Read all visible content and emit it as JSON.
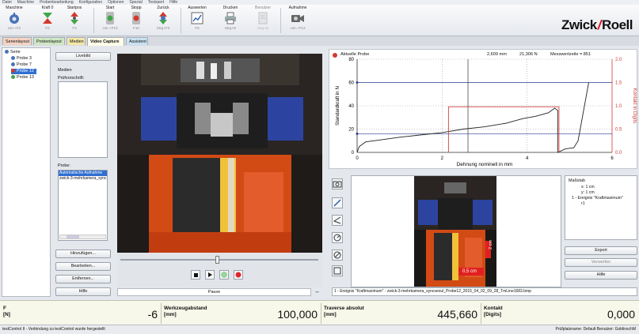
{
  "menu": [
    "Datei",
    "Maschine",
    "Probenbearbeitung",
    "Konfiguration",
    "Optionen",
    "Spezial",
    "Testxpert",
    "Hilfe"
  ],
  "toolbar": {
    "maschine": {
      "label": "Maschine",
      "shortcut": "Um.+F2"
    },
    "kraft0": {
      "label": "Kraft 0",
      "shortcut": "F2"
    },
    "startpos": {
      "label": "Startpos",
      "shortcut": "F3"
    },
    "start": {
      "label": "Start",
      "shortcut": "Um.+F10"
    },
    "stopp": {
      "label": "Stopp",
      "shortcut": "F10"
    },
    "zurueck": {
      "label": "Zurück",
      "shortcut": "Strg+F3"
    },
    "auswerten": {
      "label": "Auswerten",
      "shortcut": "F5"
    },
    "drucken": {
      "label": "Drucken",
      "shortcut": "Strg+D"
    },
    "benutzer": {
      "label": "Benutzer",
      "shortcut": "Strg+B"
    },
    "aufnahme": {
      "label": "Aufnahme",
      "shortcut": "Um.+F12"
    }
  },
  "logo": {
    "left": "Zwick",
    "right": "Roell"
  },
  "tabs": [
    "Serienlayout",
    "Probenlayout",
    "Medien",
    "Video Capture",
    "Assistent"
  ],
  "tree": {
    "root": "Serie",
    "items": [
      "Probe 3",
      "Probe 7",
      "Probe 12",
      "Probe 13"
    ]
  },
  "media": {
    "livebild": "Livebild",
    "medien": "Medien",
    "pruefvorschrift": "Prüfvorschrift:",
    "probe": "Probe:",
    "files": [
      "Automatische Aufnahme",
      "zwick-3-mehrkamera_sync"
    ],
    "hinzufuegen": "Hinzufügen...",
    "bearbeiten": "Bearbeiten...",
    "entfernen": "Entfernen...",
    "hilfe": "Hilfe"
  },
  "video": {
    "status": "Pause"
  },
  "chart_header": {
    "title": "Aktuelle Probe",
    "x_readout": "2,609 mm",
    "y_readout": "21,306 N",
    "count": "Messwertzeile = 851"
  },
  "chart_data": {
    "type": "line",
    "xlabel": "Dehnung nominell in mm",
    "ylabel": "Standardkraft in N",
    "y2label": "Kontakt in Digits",
    "xlim": [
      0,
      6
    ],
    "ylim": [
      0,
      80
    ],
    "y2lim": [
      0,
      2
    ],
    "xticks": [
      "0",
      "2",
      "4",
      "6"
    ],
    "yticks": [
      "0",
      "20",
      "40",
      "60",
      "80"
    ],
    "y2ticks": [
      "0.0",
      "0.5",
      "1.0",
      "1.5",
      "2.0"
    ],
    "series": [
      {
        "color": "#222222",
        "x": [
          0,
          0.05,
          0.2,
          0.6,
          1.0,
          1.5,
          2.0,
          2.5,
          3.0,
          3.5,
          3.9,
          4.2,
          4.5,
          4.65,
          4.72,
          4.72,
          4.9,
          5.1,
          5.2,
          5.3,
          5.45
        ],
        "y": [
          0,
          5,
          9,
          11,
          13,
          15,
          17,
          20,
          22,
          25,
          29,
          31,
          34,
          38,
          36,
          0,
          3,
          4,
          10,
          30,
          60
        ]
      },
      {
        "color": "#d04040",
        "x": [
          2.15,
          2.15,
          4.75,
          4.75
        ],
        "y": [
          0,
          0.98,
          0.98,
          0
        ]
      }
    ],
    "cursor_x": 2.609,
    "hline_y": 60
  },
  "tools": [
    "camera-icon",
    "line-icon",
    "angle-icon",
    "circle-icon",
    "circle-slash-icon",
    "rect-icon"
  ],
  "preview": {
    "label_top": "2 cm",
    "label_bottom": "0,5 cm"
  },
  "ptree": {
    "root": "Maßstab",
    "x": "x: 1 cm",
    "y": "y: 1 cm",
    "event": "1 - Ereignis \"Kraftmaximum\"",
    "sub": "r1"
  },
  "pbuttons": {
    "export": "Export",
    "verwerfen": "Verwerfen",
    "hilfe": "Hilfe"
  },
  "caption": "1 - Ereignis \"Kraftmaximum\" - zwick-3-mehrkamera_syncseoul_Probe12_2015_04_02_09_28_TmLine1683.bmp",
  "bottom": [
    {
      "label": "F",
      "unit": "[N]",
      "value": "-6"
    },
    {
      "label": "Werkzeugabstand",
      "unit": "[mm]",
      "value": "100,000"
    },
    {
      "label": "Traverse absolut",
      "unit": "[mm]",
      "value": "445,660"
    },
    {
      "label": "Kontakt",
      "unit": "[Digits]",
      "value": "0,000"
    }
  ],
  "status": {
    "left": "testControl II - Verbindung zu testControl wurde hergestellt",
    "right": "Prüfplatzname: Default   Benutzer: GoblinschM"
  }
}
